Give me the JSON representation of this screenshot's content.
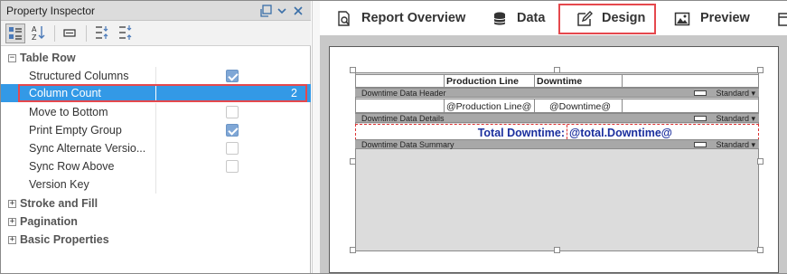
{
  "inspector": {
    "title": "Property Inspector",
    "categories": {
      "table_row": "Table Row",
      "stroke_fill": "Stroke and Fill",
      "pagination": "Pagination",
      "basic": "Basic Properties"
    },
    "properties": [
      {
        "label": "Structured Columns",
        "checked": true
      },
      {
        "label": "Column Count",
        "value": "2"
      },
      {
        "label": "Move to Bottom",
        "checked": false
      },
      {
        "label": "Print Empty Group",
        "checked": true
      },
      {
        "label": "Sync Alternate Versio...",
        "checked": false
      },
      {
        "label": "Sync Row Above",
        "checked": false
      },
      {
        "label": "Version Key",
        "value": ""
      }
    ]
  },
  "tabs": [
    {
      "label": "Report Overview",
      "icon": "search-page-icon"
    },
    {
      "label": "Data",
      "icon": "database-icon"
    },
    {
      "label": "Design",
      "icon": "edit-icon"
    },
    {
      "label": "Preview",
      "icon": "image-icon"
    }
  ],
  "report": {
    "header_row": [
      "Production Line",
      "Downtime"
    ],
    "bands": {
      "header": "Downtime Data Header",
      "details": "Downtime Data Details",
      "summary": "Downtime Data Summary",
      "standard": "Standard"
    },
    "header_cells": [
      "@Production Line@",
      "@Downtime@"
    ],
    "total_label": "Total Downtime:",
    "total_value": "@total.Downtime@"
  }
}
